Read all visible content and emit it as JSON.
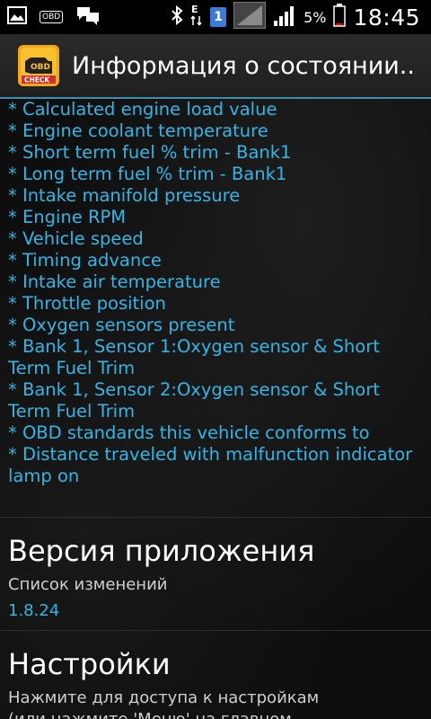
{
  "status_bar": {
    "left_icons": [
      "image-icon",
      "obd-icon",
      "chat-icon"
    ],
    "obd_badge": "OBD",
    "sim_badge": "1",
    "battery_percent": "5%",
    "time": "18:45"
  },
  "action_bar": {
    "title": "Информация о состоянии..",
    "logo_top": "OBD",
    "logo_bottom": "CHECK"
  },
  "pid_list": [
    "* Calculated engine load value",
    "* Engine coolant temperature",
    "* Short term fuel % trim - Bank1",
    "* Long term fuel % trim - Bank1",
    "* Intake manifold pressure",
    "* Engine RPM",
    "* Vehicle speed",
    "* Timing advance",
    "* Intake air temperature",
    "* Throttle position",
    "* Oxygen sensors present",
    "* Bank 1, Sensor 1:Oxygen sensor & Short Term Fuel Trim",
    "* Bank 1, Sensor 2:Oxygen sensor & Short Term Fuel Trim",
    "* OBD standards this vehicle conforms to",
    "* Distance traveled with malfunction indicator lamp on"
  ],
  "version_section": {
    "title": "Версия приложения",
    "subtitle": "Список изменений",
    "value": "1.8.24"
  },
  "settings_section": {
    "title": "Настройки",
    "subtitle_line1": "Нажмите для доступа к настройкам",
    "subtitle_line2": "(или нажмите 'Меню' на главном"
  },
  "colors": {
    "accent": "#33b5e5",
    "actionbar_border": "#3b8fb3"
  }
}
